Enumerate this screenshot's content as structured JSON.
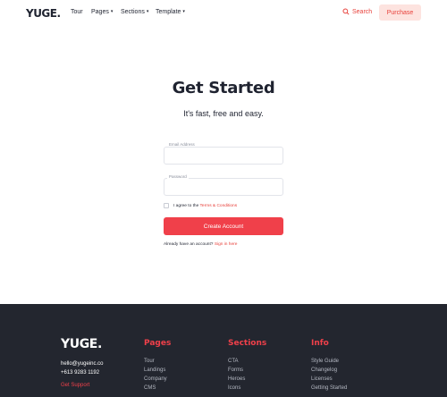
{
  "nav": {
    "logo": "YUGE.",
    "links": [
      "Tour",
      "Pages",
      "Sections",
      "Template"
    ],
    "search_label": "Search",
    "purchase_label": "Purchase"
  },
  "form": {
    "title": "Get Started",
    "subtitle": "It's fast, free and easy.",
    "email_label": "Email Address",
    "email_value": "",
    "password_label": "Password",
    "password_value": "",
    "agree_prefix": "I agree to the",
    "terms_link": "Terms & Conditions",
    "submit_label": "Create Account",
    "signin_prefix": "Already have an account?",
    "signin_link": "Sign in here"
  },
  "footer": {
    "logo": "YUGE.",
    "email": "hello@yugeinc.co",
    "phone": "+613 9283 1192",
    "support_link": "Get Support",
    "columns": [
      {
        "heading": "Pages",
        "items": [
          "Tour",
          "Landings",
          "Company",
          "CMS"
        ]
      },
      {
        "heading": "Sections",
        "items": [
          "CTA",
          "Forms",
          "Heroes",
          "Icons"
        ]
      },
      {
        "heading": "Info",
        "items": [
          "Style Guide",
          "Changelog",
          "Licenses",
          "Getting Started"
        ]
      }
    ]
  },
  "colors": {
    "accent": "#f0404a",
    "accent_soft": "#fde3df",
    "footer_bg": "#23262f",
    "text_dark": "#1f2330"
  }
}
